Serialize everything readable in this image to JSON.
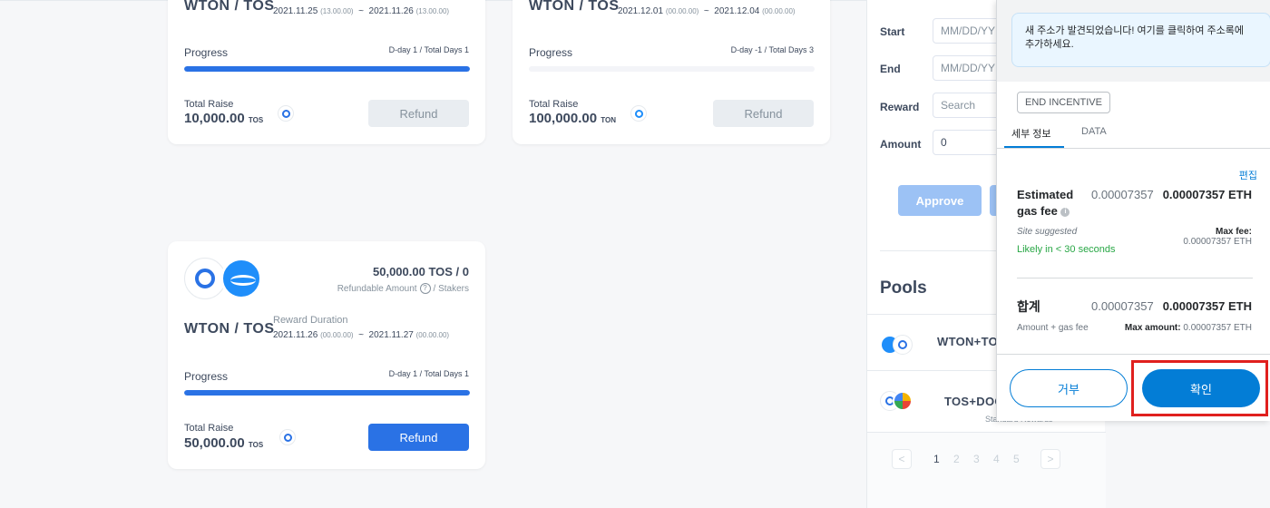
{
  "cards": [
    {
      "pair": "WTON / TOS",
      "start": "2021.11.25",
      "start_time": "(13.00.00)",
      "end": "2021.11.26",
      "end_time": "(13.00.00)",
      "progress_label": "Progress",
      "days": "D-day 1 / Total Days 1",
      "progress": 1.0,
      "raise_label": "Total Raise",
      "raise_amount": "10,000.00",
      "raise_unit": "TOS",
      "button": "Refund",
      "button_state": "disabled",
      "coin_icon": "tos-coin-icon"
    },
    {
      "pair": "WTON / TOS",
      "start": "2021.12.01",
      "start_time": "(00.00.00)",
      "end": "2021.12.04",
      "end_time": "(00.00.00)",
      "progress_label": "Progress",
      "days": "D-day -1 / Total Days 3",
      "progress": 0.0,
      "raise_label": "Total Raise",
      "raise_amount": "100,000.00",
      "raise_unit": "TON",
      "button": "Refund",
      "button_state": "disabled",
      "coin_icon": "ton-coin-icon"
    },
    {
      "pair": "WTON / TOS",
      "stake_value": "50,000.00 TOS / 0",
      "refundable_label": "Refundable Amount",
      "stakers_label": "/ Stakers",
      "duration_label": "Reward Duration",
      "start": "2021.11.26",
      "start_time": "(00.00.00)",
      "end": "2021.11.27",
      "end_time": "(00.00.00)",
      "progress_label": "Progress",
      "days": "D-day 1 / Total Days 1",
      "progress": 1.0,
      "raise_label": "Total Raise",
      "raise_amount": "50,000.00",
      "raise_unit": "TOS",
      "button": "Refund",
      "button_state": "active",
      "coin_icon": "tos-coin-icon"
    }
  ],
  "date_sep": "~",
  "help_glyph": "?",
  "side": {
    "start_label": "Start",
    "end_label": "End",
    "reward_label": "Reward",
    "amount_label": "Amount",
    "start_placeholder": "MM/DD/YY",
    "end_placeholder": "MM/DD/YY",
    "reward_placeholder": "Search",
    "amount_value": "0",
    "approve": "Approve",
    "pools_title": "Pools",
    "pools": [
      {
        "name": "WTON+TOS"
      },
      {
        "name": "TOS+DOC"
      }
    ],
    "pool_sub": "Standard Rewards",
    "pages": [
      "1",
      "2",
      "3",
      "4",
      "5"
    ],
    "prev": "<",
    "next": ">"
  },
  "metamask": {
    "notice": "새 주소가 발견되었습니다! 여기를 클릭하여 주소록에 추가하세요.",
    "badge": "END INCENTIVE",
    "tab_details": "세부 정보",
    "tab_data": "DATA",
    "edit": "편집",
    "fee_label": "Estimated gas fee",
    "fee_gray": "0.00007357",
    "fee_bold": "0.00007357 ETH",
    "site_suggested": "Site suggested",
    "likely": "Likely in < 30 seconds",
    "max_fee_label": "Max fee:",
    "max_fee_value": "0.00007357 ETH",
    "total_label": "합계",
    "total_gray": "0.00007357",
    "total_bold": "0.00007357 ETH",
    "amount_gas": "Amount + gas fee",
    "max_amount_label": "Max amount:",
    "max_amount_value": "0.00007357 ETH",
    "reject": "거부",
    "confirm": "확인",
    "info_glyph": "i"
  }
}
